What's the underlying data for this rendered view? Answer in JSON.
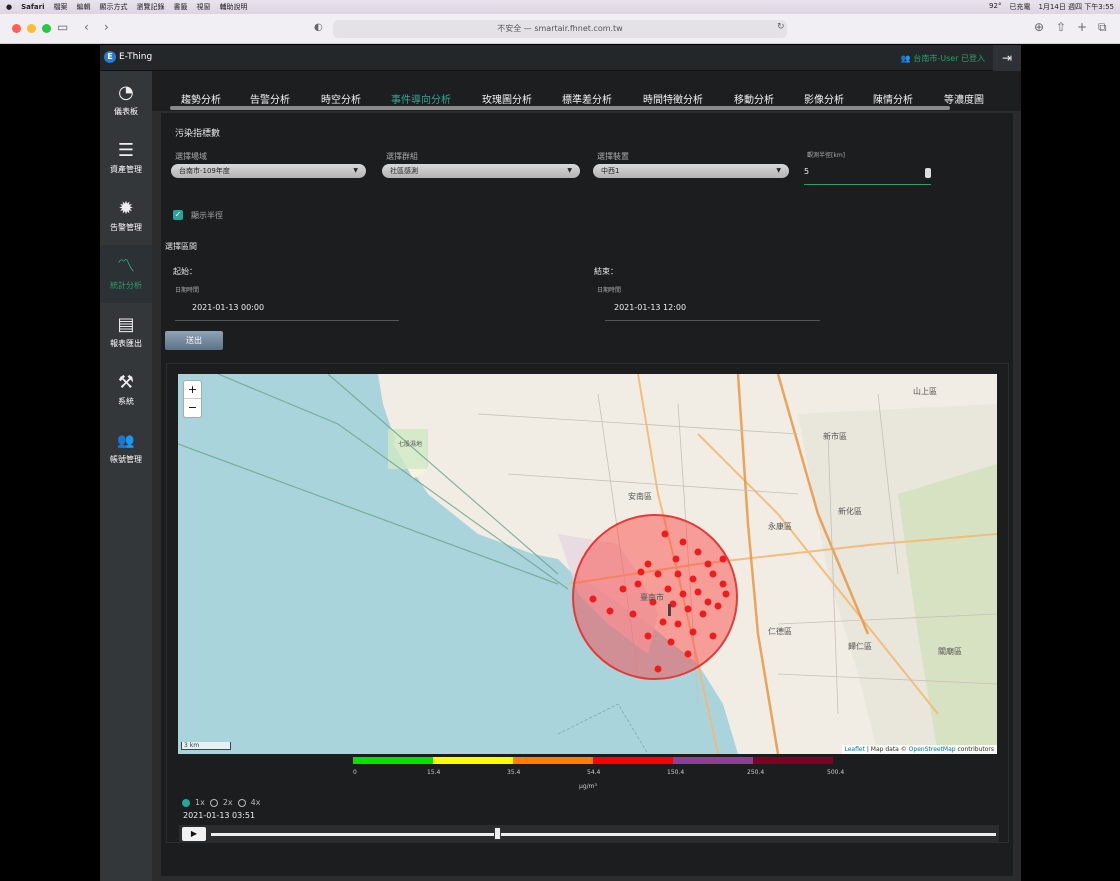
{
  "menubar": {
    "items": [
      "Safari",
      "檔案",
      "編輯",
      "顯示方式",
      "瀏覽記錄",
      "書籤",
      "視窗",
      "輔助說明"
    ],
    "temp": "92°",
    "charging": "已充電",
    "clock": "1月14日 週四 下午3:55"
  },
  "browser": {
    "url": "不安全 — smartair.fhnet.com.tw"
  },
  "app": {
    "logo_letter": "E",
    "logo_text": "E-Thing",
    "user": "台南市-User 已登入",
    "logout_icon": "⇥"
  },
  "sidebar": {
    "items": [
      {
        "label": "儀表板",
        "icon": "speedometer-icon",
        "glyph": "◔"
      },
      {
        "label": "資產管理",
        "icon": "server-icon",
        "glyph": "☰"
      },
      {
        "label": "告警管理",
        "icon": "alert-icon",
        "glyph": "✹"
      },
      {
        "label": "統計分析",
        "icon": "chart-line-icon",
        "glyph": "〽"
      },
      {
        "label": "報表匯出",
        "icon": "newspaper-icon",
        "glyph": "▤"
      },
      {
        "label": "系統",
        "icon": "tools-icon",
        "glyph": "⚒"
      },
      {
        "label": "帳號管理",
        "icon": "users-icon",
        "glyph": "👥"
      }
    ]
  },
  "tabs": [
    "趨勢分析",
    "告警分析",
    "時空分析",
    "事件導向分析",
    "玫瑰圖分析",
    "標準差分析",
    "時間特徵分析",
    "移動分析",
    "影像分析",
    "陳情分析",
    "等濃度圖"
  ],
  "form": {
    "pollutant_title": "污染指標數",
    "area_label": "選擇場域",
    "area_value": "台南市-109年度",
    "group_label": "選擇群組",
    "group_value": "社區感測",
    "device_label": "選擇裝置",
    "device_value": "中西1",
    "radius_label": "觀測半徑[km]",
    "radius_value": "5",
    "show_radius": "顯示半徑",
    "range_title": "選擇區間",
    "start_label": "起始：",
    "end_label": "結束：",
    "datetime_label": "日期時間",
    "start_value": "2021-01-13 00:00",
    "end_value": "2021-01-13 12:00",
    "submit": "送出"
  },
  "map": {
    "zoom_in": "+",
    "zoom_out": "−",
    "scale": "3 km",
    "attribution_leaflet": "Leaflet",
    "attribution_mid": " | Map data © ",
    "attribution_osm": "OpenStreetMap",
    "attribution_end": " contributors",
    "labels": {
      "l1": "安南區",
      "l2": "臺南市",
      "l3": "永康區",
      "l4": "新市區",
      "l5": "新化區",
      "l6": "仁德區",
      "l7": "歸仁區",
      "l8": "關廟區",
      "l9": "山上區",
      "l10": "七股濕地"
    }
  },
  "legend": {
    "colors": [
      "#00e400",
      "#ffff00",
      "#ff7e00",
      "#ff0000",
      "#8f3f97",
      "#7e0023"
    ],
    "ticks": [
      "0",
      "15.4",
      "35.4",
      "54.4",
      "150.4",
      "250.4",
      "500.4"
    ],
    "unit": "μg/m³"
  },
  "playback": {
    "speeds": [
      "1x",
      "2x",
      "4x"
    ],
    "selected": "1x",
    "time": "2021-01-13 03:51",
    "progress": 0.36
  }
}
